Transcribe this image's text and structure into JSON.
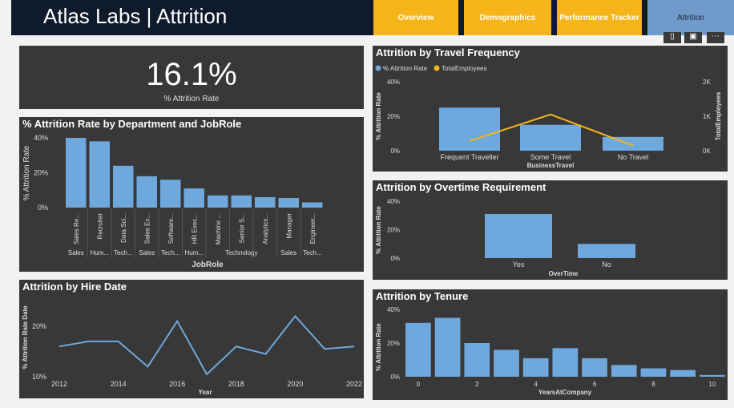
{
  "header": {
    "title": "Atlas Labs | Attrition",
    "tabs": [
      {
        "label": "Overview"
      },
      {
        "label": "Demographics"
      },
      {
        "label": "Performance Tracker"
      },
      {
        "label": "Attrition"
      }
    ]
  },
  "kpi": {
    "value": "16.1%",
    "label": "% Attrition Rate"
  },
  "dept_chart": {
    "title": "% Attrition Rate by Department and JobRole",
    "chart_data": {
      "type": "bar",
      "title": "% Attrition Rate by Department and JobRole",
      "xlabel": "JobRole",
      "ylabel": "% Attrition Rate",
      "ylim": [
        0,
        40
      ],
      "yticks": [
        "0%",
        "20%",
        "40%"
      ],
      "categories": [
        "Sales Re...",
        "Recruiter",
        "Data Sci...",
        "Sales Ex...",
        "Software...",
        "HR Exec...",
        "Machine ...",
        "Senior S...",
        "Analytics...",
        "Manager",
        "Engineer..."
      ],
      "values": [
        40,
        38,
        24,
        18,
        16,
        11,
        7,
        7,
        6,
        5.5,
        3
      ],
      "groups": [
        {
          "label": "Sales",
          "span": [
            0,
            0
          ]
        },
        {
          "label": "Hum...",
          "span": [
            1,
            1
          ]
        },
        {
          "label": "Tech...",
          "span": [
            2,
            2
          ]
        },
        {
          "label": "Sales",
          "span": [
            3,
            3
          ]
        },
        {
          "label": "Tech...",
          "span": [
            4,
            4
          ]
        },
        {
          "label": "Hum...",
          "span": [
            5,
            5
          ]
        },
        {
          "label": "Technology",
          "span": [
            6,
            8
          ]
        },
        {
          "label": "Sales",
          "span": [
            9,
            9
          ]
        },
        {
          "label": "Tech...",
          "span": [
            10,
            10
          ]
        }
      ]
    }
  },
  "hire_chart": {
    "title": "Attrition by Hire Date",
    "chart_data": {
      "type": "line",
      "xlabel": "Year",
      "ylabel": "% Attrition Rate Date",
      "ylim": [
        10,
        25
      ],
      "yticks": [
        {
          "v": 10,
          "label": "10%"
        },
        {
          "v": 20,
          "label": "20%"
        }
      ],
      "xticks": [
        "2012",
        "2014",
        "2016",
        "2018",
        "2020",
        "2022"
      ],
      "x": [
        2012,
        2013,
        2014,
        2015,
        2016,
        2017,
        2018,
        2019,
        2020,
        2021,
        2022
      ],
      "values": [
        16,
        17,
        17,
        12,
        21,
        10.5,
        16,
        14.5,
        22,
        15.5,
        16
      ]
    }
  },
  "travel_chart": {
    "title": "Attrition by Travel Frequency",
    "chart_data": {
      "type": "bar",
      "xlabel": "BusinessTravel",
      "ylabel": "% Attrition Rate",
      "y2label": "TotalEmployees",
      "ylim": [
        0,
        40
      ],
      "y2lim": [
        0,
        2000
      ],
      "yticks": [
        "0%",
        "20%",
        "40%"
      ],
      "y2ticks": [
        "0K",
        "1K",
        "2K"
      ],
      "categories": [
        "Frequent Traveller",
        "Some Travel",
        "No Travel"
      ],
      "series": [
        {
          "name": "% Attrition Rate",
          "type": "bar",
          "color": "#6fa8dc",
          "values": [
            25,
            15,
            8
          ]
        },
        {
          "name": "TotalEmployees",
          "type": "line",
          "color": "#f5b51a",
          "values": [
            280,
            1050,
            150
          ]
        }
      ]
    }
  },
  "overtime_chart": {
    "title": "Attrition by Overtime Requirement",
    "chart_data": {
      "type": "bar",
      "xlabel": "OverTime",
      "ylabel": "% Attrition Rate",
      "ylim": [
        0,
        40
      ],
      "yticks": [
        "0%",
        "20%",
        "40%"
      ],
      "categories": [
        "Yes",
        "No"
      ],
      "values": [
        31,
        10
      ]
    }
  },
  "tenure_chart": {
    "title": "Attrition by Tenure",
    "chart_data": {
      "type": "bar",
      "xlabel": "YearsAtCompany",
      "ylabel": "% Attrition Rate",
      "ylim": [
        0,
        40
      ],
      "yticks": [
        "0%",
        "20%",
        "40%"
      ],
      "xticks": [
        "0",
        "2",
        "4",
        "6",
        "8",
        "10"
      ],
      "categories": [
        "0",
        "1",
        "2",
        "3",
        "4",
        "5",
        "6",
        "7",
        "8",
        "9",
        "10"
      ],
      "values": [
        32,
        35,
        20,
        16,
        11,
        17,
        11,
        7,
        5,
        4,
        1
      ]
    }
  },
  "colors": {
    "bar": "#6fa8dc",
    "line_accent": "#f5b51a",
    "panel": "#383838",
    "header": "#0f1a2b"
  }
}
